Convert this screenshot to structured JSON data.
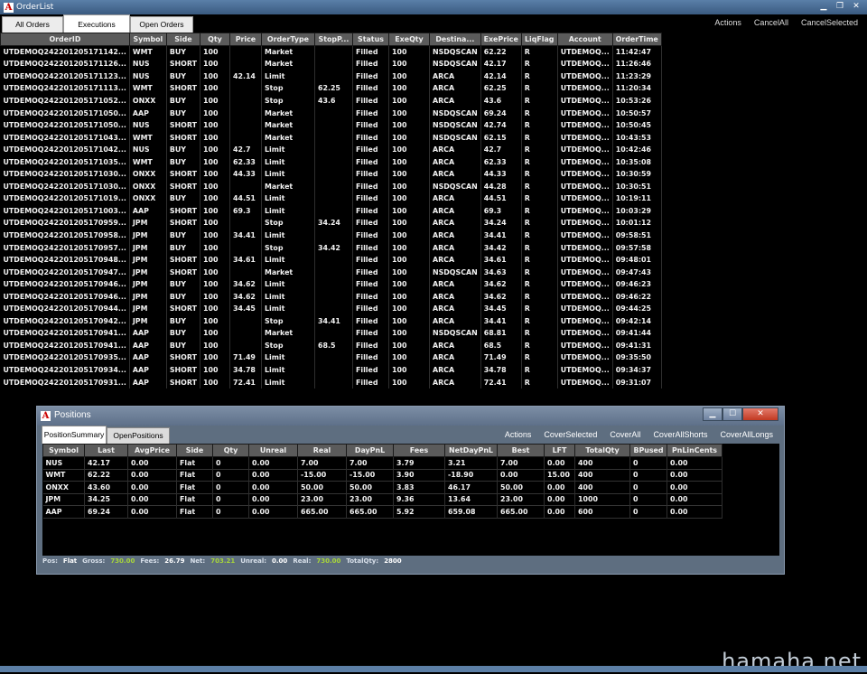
{
  "window": {
    "title": "OrderList"
  },
  "tabs": [
    "All Orders",
    "Executions",
    "Open Orders"
  ],
  "active_tab": "Executions",
  "actions": [
    "Actions",
    "CancelAll",
    "CancelSelected"
  ],
  "columns": [
    "OrderID",
    "Symbol",
    "Side",
    "Qty",
    "Price",
    "OrderType",
    "StopP...",
    "Status",
    "ExeQty",
    "Destina...",
    "ExePrice",
    "LiqFlag",
    "Account",
    "OrderTime"
  ],
  "rows": [
    [
      "UTDEMOQ242201205171142...",
      "WMT",
      "BUY",
      "100",
      "",
      "Market",
      "",
      "Filled",
      "100",
      "NSDQSCAN",
      "62.22",
      "R",
      "UTDEMOQ...",
      "11:42:47"
    ],
    [
      "UTDEMOQ242201205171126...",
      "NUS",
      "SHORT",
      "100",
      "",
      "Market",
      "",
      "Filled",
      "100",
      "NSDQSCAN",
      "42.17",
      "R",
      "UTDEMOQ...",
      "11:26:46"
    ],
    [
      "UTDEMOQ242201205171123...",
      "NUS",
      "BUY",
      "100",
      "42.14",
      "Limit",
      "",
      "Filled",
      "100",
      "ARCA",
      "42.14",
      "R",
      "UTDEMOQ...",
      "11:23:29"
    ],
    [
      "UTDEMOQ242201205171113...",
      "WMT",
      "SHORT",
      "100",
      "",
      "Stop",
      "62.25",
      "Filled",
      "100",
      "ARCA",
      "62.25",
      "R",
      "UTDEMOQ...",
      "11:20:34"
    ],
    [
      "UTDEMOQ242201205171052...",
      "ONXX",
      "BUY",
      "100",
      "",
      "Stop",
      "43.6",
      "Filled",
      "100",
      "ARCA",
      "43.6",
      "R",
      "UTDEMOQ...",
      "10:53:26"
    ],
    [
      "UTDEMOQ242201205171050...",
      "AAP",
      "BUY",
      "100",
      "",
      "Market",
      "",
      "Filled",
      "100",
      "NSDQSCAN",
      "69.24",
      "R",
      "UTDEMOQ...",
      "10:50:57"
    ],
    [
      "UTDEMOQ242201205171050...",
      "NUS",
      "SHORT",
      "100",
      "",
      "Market",
      "",
      "Filled",
      "100",
      "NSDQSCAN",
      "42.74",
      "R",
      "UTDEMOQ...",
      "10:50:45"
    ],
    [
      "UTDEMOQ242201205171043...",
      "WMT",
      "SHORT",
      "100",
      "",
      "Market",
      "",
      "Filled",
      "100",
      "NSDQSCAN",
      "62.15",
      "R",
      "UTDEMOQ...",
      "10:43:53"
    ],
    [
      "UTDEMOQ242201205171042...",
      "NUS",
      "BUY",
      "100",
      "42.7",
      "Limit",
      "",
      "Filled",
      "100",
      "ARCA",
      "42.7",
      "R",
      "UTDEMOQ...",
      "10:42:46"
    ],
    [
      "UTDEMOQ242201205171035...",
      "WMT",
      "BUY",
      "100",
      "62.33",
      "Limit",
      "",
      "Filled",
      "100",
      "ARCA",
      "62.33",
      "R",
      "UTDEMOQ...",
      "10:35:08"
    ],
    [
      "UTDEMOQ242201205171030...",
      "ONXX",
      "SHORT",
      "100",
      "44.33",
      "Limit",
      "",
      "Filled",
      "100",
      "ARCA",
      "44.33",
      "R",
      "UTDEMOQ...",
      "10:30:59"
    ],
    [
      "UTDEMOQ242201205171030...",
      "ONXX",
      "SHORT",
      "100",
      "",
      "Market",
      "",
      "Filled",
      "100",
      "NSDQSCAN",
      "44.28",
      "R",
      "UTDEMOQ...",
      "10:30:51"
    ],
    [
      "UTDEMOQ242201205171019...",
      "ONXX",
      "BUY",
      "100",
      "44.51",
      "Limit",
      "",
      "Filled",
      "100",
      "ARCA",
      "44.51",
      "R",
      "UTDEMOQ...",
      "10:19:11"
    ],
    [
      "UTDEMOQ242201205171003...",
      "AAP",
      "SHORT",
      "100",
      "69.3",
      "Limit",
      "",
      "Filled",
      "100",
      "ARCA",
      "69.3",
      "R",
      "UTDEMOQ...",
      "10:03:29"
    ],
    [
      "UTDEMOQ242201205170959...",
      "JPM",
      "SHORT",
      "100",
      "",
      "Stop",
      "34.24",
      "Filled",
      "100",
      "ARCA",
      "34.24",
      "R",
      "UTDEMOQ...",
      "10:01:12"
    ],
    [
      "UTDEMOQ242201205170958...",
      "JPM",
      "BUY",
      "100",
      "34.41",
      "Limit",
      "",
      "Filled",
      "100",
      "ARCA",
      "34.41",
      "R",
      "UTDEMOQ...",
      "09:58:51"
    ],
    [
      "UTDEMOQ242201205170957...",
      "JPM",
      "BUY",
      "100",
      "",
      "Stop",
      "34.42",
      "Filled",
      "100",
      "ARCA",
      "34.42",
      "R",
      "UTDEMOQ...",
      "09:57:58"
    ],
    [
      "UTDEMOQ242201205170948...",
      "JPM",
      "SHORT",
      "100",
      "34.61",
      "Limit",
      "",
      "Filled",
      "100",
      "ARCA",
      "34.61",
      "R",
      "UTDEMOQ...",
      "09:48:01"
    ],
    [
      "UTDEMOQ242201205170947...",
      "JPM",
      "SHORT",
      "100",
      "",
      "Market",
      "",
      "Filled",
      "100",
      "NSDQSCAN",
      "34.63",
      "R",
      "UTDEMOQ...",
      "09:47:43"
    ],
    [
      "UTDEMOQ242201205170946...",
      "JPM",
      "BUY",
      "100",
      "34.62",
      "Limit",
      "",
      "Filled",
      "100",
      "ARCA",
      "34.62",
      "R",
      "UTDEMOQ...",
      "09:46:23"
    ],
    [
      "UTDEMOQ242201205170946...",
      "JPM",
      "BUY",
      "100",
      "34.62",
      "Limit",
      "",
      "Filled",
      "100",
      "ARCA",
      "34.62",
      "R",
      "UTDEMOQ...",
      "09:46:22"
    ],
    [
      "UTDEMOQ242201205170944...",
      "JPM",
      "SHORT",
      "100",
      "34.45",
      "Limit",
      "",
      "Filled",
      "100",
      "ARCA",
      "34.45",
      "R",
      "UTDEMOQ...",
      "09:44:25"
    ],
    [
      "UTDEMOQ242201205170942...",
      "JPM",
      "BUY",
      "100",
      "",
      "Stop",
      "34.41",
      "Filled",
      "100",
      "ARCA",
      "34.41",
      "R",
      "UTDEMOQ...",
      "09:42:14"
    ],
    [
      "UTDEMOQ242201205170941...",
      "AAP",
      "BUY",
      "100",
      "",
      "Market",
      "",
      "Filled",
      "100",
      "NSDQSCAN",
      "68.81",
      "R",
      "UTDEMOQ...",
      "09:41:44"
    ],
    [
      "UTDEMOQ242201205170941...",
      "AAP",
      "BUY",
      "100",
      "",
      "Stop",
      "68.5",
      "Filled",
      "100",
      "ARCA",
      "68.5",
      "R",
      "UTDEMOQ...",
      "09:41:31"
    ],
    [
      "UTDEMOQ242201205170935...",
      "AAP",
      "SHORT",
      "100",
      "71.49",
      "Limit",
      "",
      "Filled",
      "100",
      "ARCA",
      "71.49",
      "R",
      "UTDEMOQ...",
      "09:35:50"
    ],
    [
      "UTDEMOQ242201205170934...",
      "AAP",
      "SHORT",
      "100",
      "34.78",
      "Limit",
      "",
      "Filled",
      "100",
      "ARCA",
      "34.78",
      "R",
      "UTDEMOQ...",
      "09:34:37"
    ],
    [
      "UTDEMOQ242201205170931...",
      "AAP",
      "SHORT",
      "100",
      "72.41",
      "Limit",
      "",
      "Filled",
      "100",
      "ARCA",
      "72.41",
      "R",
      "UTDEMOQ...",
      "09:31:07"
    ]
  ],
  "positions": {
    "title": "Positions",
    "tabs": [
      "PositionSummary",
      "OpenPositions"
    ],
    "active_tab": "PositionSummary",
    "actions": [
      "Actions",
      "CoverSelected",
      "CoverAll",
      "CoverAllShorts",
      "CoverAllLongs"
    ],
    "columns": [
      "Symbol",
      "Last",
      "AvgPrice",
      "Side",
      "Qty",
      "Unreal",
      "Real",
      "DayPnL",
      "Fees",
      "NetDayPnL",
      "Best",
      "LFT",
      "TotalQty",
      "BPused",
      "PnLinCents"
    ],
    "rows": [
      [
        "NUS",
        "42.17",
        "0.00",
        "Flat",
        "0",
        "0.00",
        "7.00",
        "7.00",
        "3.79",
        "3.21",
        "7.00",
        "0.00",
        "400",
        "0",
        "0.00"
      ],
      [
        "WMT",
        "62.22",
        "0.00",
        "Flat",
        "0",
        "0.00",
        "-15.00",
        "-15.00",
        "3.90",
        "-18.90",
        "0.00",
        "15.00",
        "400",
        "0",
        "0.00"
      ],
      [
        "ONXX",
        "43.60",
        "0.00",
        "Flat",
        "0",
        "0.00",
        "50.00",
        "50.00",
        "3.83",
        "46.17",
        "50.00",
        "0.00",
        "400",
        "0",
        "0.00"
      ],
      [
        "JPM",
        "34.25",
        "0.00",
        "Flat",
        "0",
        "0.00",
        "23.00",
        "23.00",
        "9.36",
        "13.64",
        "23.00",
        "0.00",
        "1000",
        "0",
        "0.00"
      ],
      [
        "AAP",
        "69.24",
        "0.00",
        "Flat",
        "0",
        "0.00",
        "665.00",
        "665.00",
        "5.92",
        "659.08",
        "665.00",
        "0.00",
        "600",
        "0",
        "0.00"
      ]
    ],
    "status": {
      "pos_label": "Pos:",
      "pos_value": "Flat",
      "gross_label": "Gross:",
      "gross_value": "730.00",
      "fees_label": "Fees:",
      "fees_value": "26.79",
      "net_label": "Net:",
      "net_value": "703.21",
      "unreal_label": "Unreal:",
      "unreal_value": "0.00",
      "real_label": "Real:",
      "real_value": "730.00",
      "totalqty_label": "TotalQty:",
      "totalqty_value": "2800"
    }
  },
  "colors": {
    "buy": "#a8d63a",
    "short": "#ff2a2a",
    "filled": "#86c933",
    "negative": "#ff3030",
    "positive": "#b6e04a"
  },
  "watermark": "hamaha.net"
}
